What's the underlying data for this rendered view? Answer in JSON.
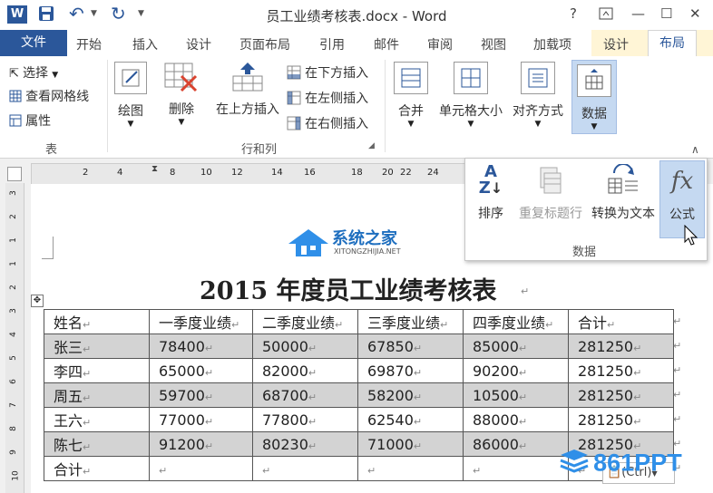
{
  "window": {
    "title": "员工业绩考核表.docx - Word",
    "help": "?",
    "min": "—",
    "max": "☐",
    "close": "✕"
  },
  "tabs": {
    "file": "文件",
    "items": [
      "开始",
      "插入",
      "设计",
      "页面布局",
      "引用",
      "邮件",
      "审阅",
      "视图",
      "加载项"
    ],
    "context_design": "设计",
    "context_layout": "布局"
  },
  "ribbon": {
    "table_group": {
      "select": "选择",
      "gridlines": "查看网格线",
      "properties": "属性",
      "name": "表"
    },
    "draw": "绘图",
    "delete": "删除",
    "insert_above": "在上方插入",
    "insert_below": "在下方插入",
    "insert_left": "在左侧插入",
    "insert_right": "在右侧插入",
    "rows_cols_name": "行和列",
    "merge": "合并",
    "cell_size": "单元格大小",
    "alignment": "对齐方式",
    "data": "数据"
  },
  "ruler": {
    "marks": [
      "2",
      "4",
      "8",
      "10",
      "12",
      "14",
      "16",
      "18",
      "20",
      "22",
      "24"
    ]
  },
  "vruler": {
    "marks": [
      "3",
      "2",
      "1",
      "1",
      "2",
      "3",
      "4",
      "5",
      "6",
      "7",
      "8",
      "9",
      "10"
    ]
  },
  "popup": {
    "sort": "排序",
    "repeat_header": "重复标题行",
    "convert_text": "转换为文本",
    "formula": "公式",
    "group_name": "数据"
  },
  "logo": {
    "name": "系统之家",
    "url": "XITONGZHIJIA.NET"
  },
  "document": {
    "title": "2015 年度员工业绩考核表",
    "headers": [
      "姓名",
      "一季度业绩",
      "二季度业绩",
      "三季度业绩",
      "四季度业绩",
      "合计"
    ],
    "rows": [
      [
        "张三",
        "78400",
        "50000",
        "67850",
        "85000",
        "281250"
      ],
      [
        "李四",
        "65000",
        "82000",
        "69870",
        "90200",
        "281250"
      ],
      [
        "周五",
        "59700",
        "68700",
        "58200",
        "10500",
        "281250"
      ],
      [
        "王六",
        "77000",
        "77800",
        "62540",
        "88000",
        "281250"
      ],
      [
        "陈七",
        "91200",
        "80230",
        "71000",
        "86000",
        "281250"
      ]
    ],
    "total_label": "合计"
  },
  "paste_options": "(Ctrl)",
  "watermark": "861PPT",
  "colors": {
    "accent": "#2b579a",
    "shade": "#d3d3d3",
    "watermark": "#2f8fe8"
  }
}
